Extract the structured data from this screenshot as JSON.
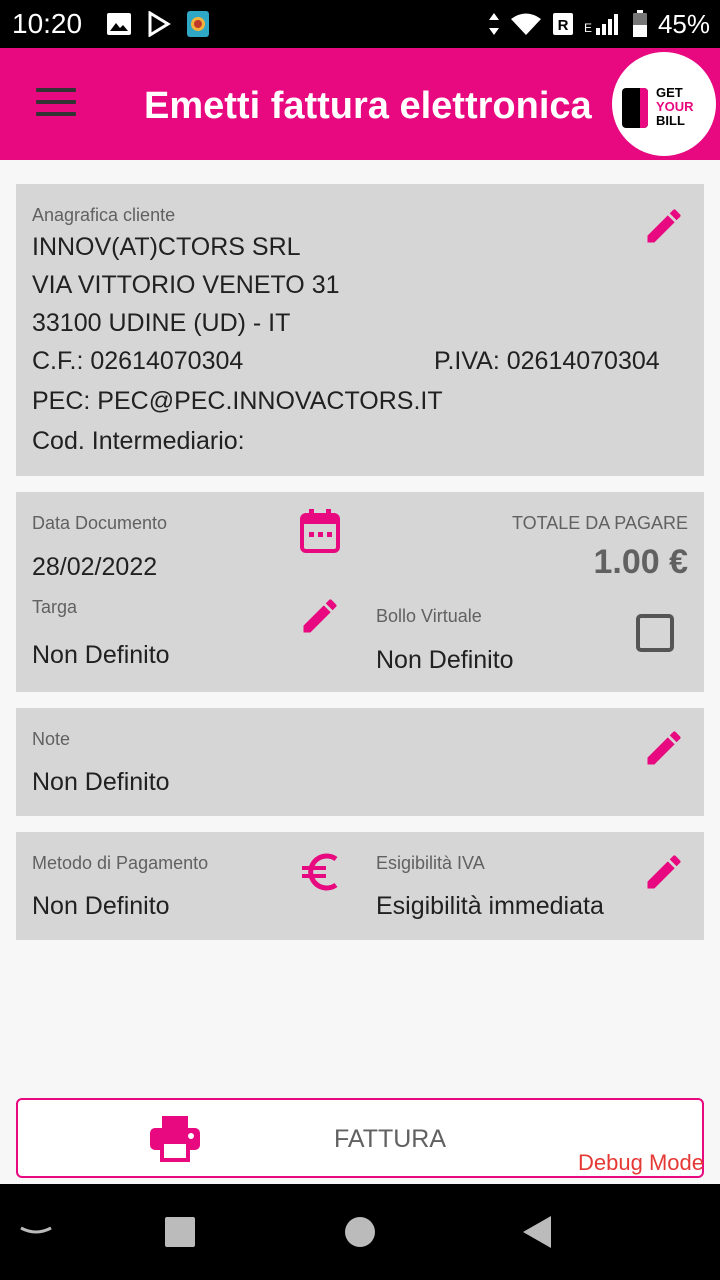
{
  "status": {
    "time": "10:20",
    "battery": "45%"
  },
  "appbar": {
    "title": "Emetti fattura elettronica",
    "logo_alt_name": "get-your-bill-logo"
  },
  "client": {
    "label": "Anagrafica cliente",
    "name": "INNOV(AT)CTORS SRL",
    "address": "VIA VITTORIO VENETO 31",
    "city": "33100 UDINE (UD) - IT",
    "cf": "C.F.: 02614070304",
    "piva": "P.IVA: 02614070304",
    "pec": "PEC: PEC@PEC.INNOVACTORS.IT",
    "intermediary": "Cod. Intermediario:"
  },
  "document": {
    "date_label": "Data Documento",
    "date_value": "28/02/2022",
    "total_label": "TOTALE DA PAGARE",
    "total_value": "1.00 €",
    "plate_label": "Targa",
    "plate_value": "Non Definito",
    "stamp_label": "Bollo Virtuale",
    "stamp_value": "Non Definito"
  },
  "notes": {
    "label": "Note",
    "value": "Non Definito"
  },
  "payment": {
    "method_label": "Metodo di Pagamento",
    "method_value": "Non Definito",
    "vat_label": "Esigibilità IVA",
    "vat_value": "Esigibilità immediata"
  },
  "action": {
    "label": "FATTURA"
  },
  "debug": "Debug Mode",
  "colors": {
    "accent": "#e8087f",
    "card": "#d6d6d6",
    "debug": "#e53935"
  },
  "icons": [
    "menu-icon",
    "edit-icon",
    "calendar-icon",
    "checkbox-icon",
    "euro-icon",
    "printer-icon"
  ]
}
